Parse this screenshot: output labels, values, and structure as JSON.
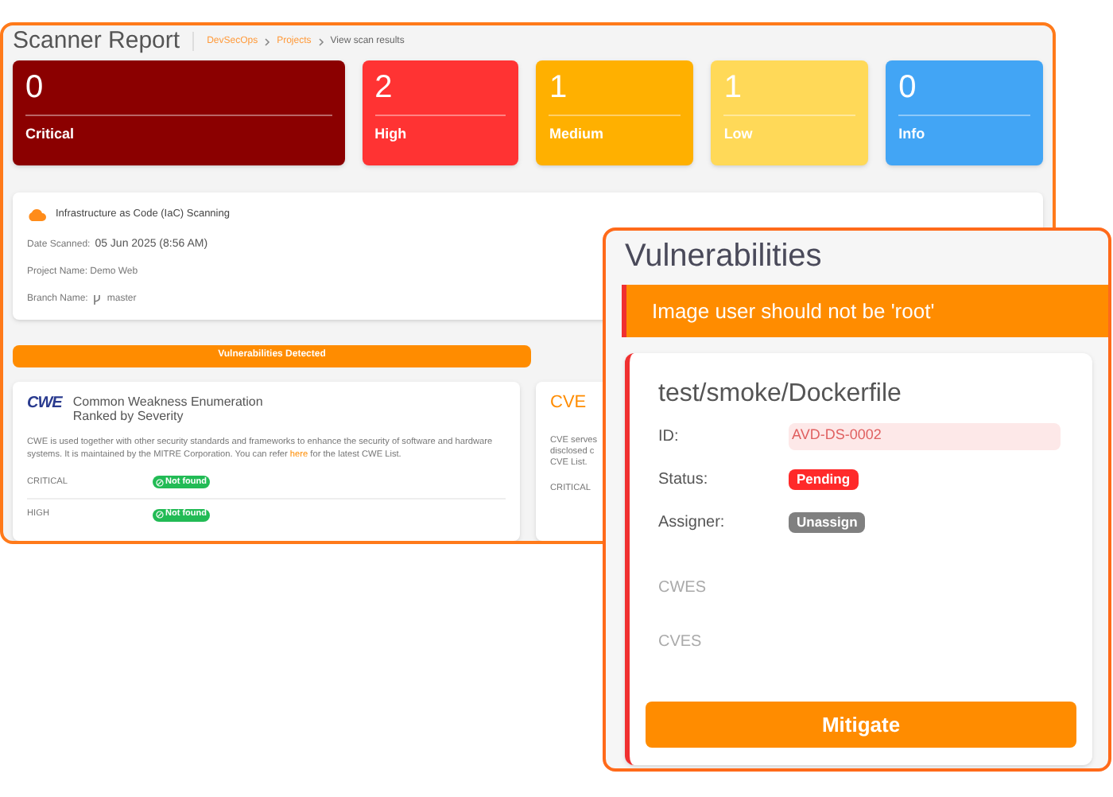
{
  "report": {
    "title": "Scanner Report",
    "breadcrumbs": [
      {
        "label": "DevSecOps",
        "link": true
      },
      {
        "label": "Projects",
        "link": true
      },
      {
        "label": "View scan results",
        "link": false
      }
    ],
    "severities": [
      {
        "count": "0",
        "label": "Critical",
        "color": "#8b0000"
      },
      {
        "count": "2",
        "label": "High",
        "color": "#ff3333"
      },
      {
        "count": "1",
        "label": "Medium",
        "color": "#ffb000"
      },
      {
        "count": "1",
        "label": "Low",
        "color": "#ffd958"
      },
      {
        "count": "0",
        "label": "Info",
        "color": "#42a5f5"
      }
    ],
    "scan": {
      "type": "Infrastructure as Code (IaC) Scanning",
      "date_label": "Date Scanned:",
      "date": "05 Jun 2025 (8:56 AM)",
      "project": "Project Name: Demo Web",
      "branch_label": "Branch Name:",
      "branch": "master"
    },
    "banner": "Vulnerabilities Detected",
    "cwe": {
      "logo": "CWE",
      "title_lines": [
        "Common Weakness Enumeration",
        "Ranked by Severity"
      ],
      "text_before": "CWE is used together with other security standards and frameworks to enhance the security of software and hardware systems. It is maintained by the MITRE Corporation. You can refer",
      "link": "here",
      "text_after": "for the latest CWE List.",
      "rows": [
        {
          "label": "CRITICAL",
          "badge": "Not found"
        },
        {
          "label": "HIGH",
          "badge": "Not found"
        }
      ]
    },
    "cve": {
      "logo": "CVE",
      "text_lines": [
        "CVE serves",
        "disclosed c",
        "CVE List."
      ],
      "rows": [
        {
          "label": "CRITICAL"
        }
      ]
    }
  },
  "detail": {
    "title": "Vulnerabilities",
    "alert": "Image user should not be 'root'",
    "file": "test/smoke/Dockerfile",
    "fields": [
      {
        "label": "ID:",
        "value": "AVD-DS-0002",
        "kind": "id"
      },
      {
        "label": "Status:",
        "value": "Pending",
        "kind": "status"
      },
      {
        "label": "Assigner:",
        "value": "Unassign",
        "kind": "assignee"
      }
    ],
    "sections": [
      "CWES",
      "CVES"
    ],
    "button": "Mitigate"
  }
}
